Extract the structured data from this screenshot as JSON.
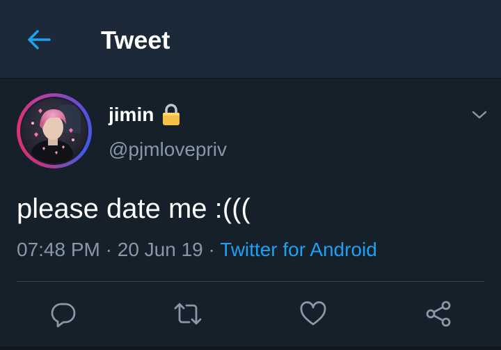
{
  "header": {
    "title": "Tweet",
    "back_icon": "arrow-left-icon"
  },
  "tweet": {
    "author": {
      "name": "jimin",
      "handle": "@pjmlovepriv",
      "protected_icon": "lock-icon",
      "avatar": "avatar-photo"
    },
    "text": "please date me :(((",
    "time": "07:48 PM",
    "separator": "·",
    "date": "20 Jun 19",
    "source": "Twitter for Android"
  },
  "actions": [
    {
      "name": "reply",
      "icon": "reply-icon"
    },
    {
      "name": "retweet",
      "icon": "retweet-icon"
    },
    {
      "name": "like",
      "icon": "heart-icon"
    },
    {
      "name": "share",
      "icon": "share-icon"
    }
  ],
  "colors": {
    "background": "#15202b",
    "header_bg": "#1c2938",
    "text_primary": "#ffffff",
    "text_secondary": "#8899a6",
    "accent": "#1da1f2",
    "divider": "#38444d"
  }
}
